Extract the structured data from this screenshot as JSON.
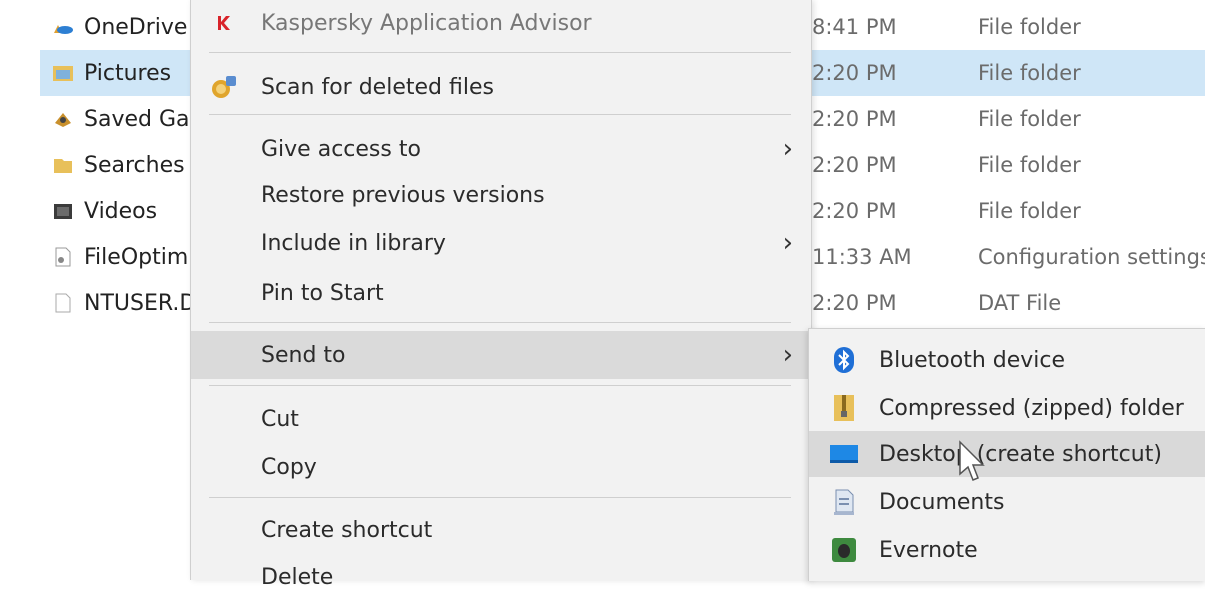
{
  "files": [
    {
      "name": "OneDrive",
      "date": "8:41 PM",
      "type": "File folder",
      "icon": "onedrive-icon",
      "selected": false
    },
    {
      "name": "Pictures",
      "date": "2:20 PM",
      "type": "File folder",
      "icon": "pictures-folder-icon",
      "selected": true
    },
    {
      "name": "Saved Games",
      "date": "2:20 PM",
      "type": "File folder",
      "icon": "saved-games-icon",
      "selected": false
    },
    {
      "name": "Searches",
      "date": "2:20 PM",
      "type": "File folder",
      "icon": "searches-folder-icon",
      "selected": false
    },
    {
      "name": "Videos",
      "date": "2:20 PM",
      "type": "File folder",
      "icon": "videos-folder-icon",
      "selected": false
    },
    {
      "name": "FileOptimizer",
      "date": "11:33 AM",
      "type": "Configuration settings",
      "icon": "config-file-icon",
      "selected": false
    },
    {
      "name": "NTUSER.DAT",
      "date": "2:20 PM",
      "type": "DAT File",
      "icon": "blank-file-icon",
      "selected": false
    }
  ],
  "context_menu": {
    "kaspersky": "Kaspersky Application Advisor",
    "scan_deleted": "Scan for deleted files",
    "give_access": "Give access to",
    "restore_versions": "Restore previous versions",
    "include_library": "Include in library",
    "pin_start": "Pin to Start",
    "send_to": "Send to",
    "cut": "Cut",
    "copy": "Copy",
    "create_shortcut": "Create shortcut",
    "delete": "Delete",
    "submenu_arrow": "›"
  },
  "send_to_menu": {
    "bluetooth": "Bluetooth device",
    "compressed": "Compressed (zipped) folder",
    "desktop": "Desktop (create shortcut)",
    "documents": "Documents",
    "evernote": "Evernote"
  },
  "colors": {
    "selection": "#cfe6f7",
    "menu_bg": "#f2f2f2",
    "menu_hover": "#dadada",
    "bluetooth": "#1f6fd6",
    "evernote": "#3e8a3f",
    "kaspersky": "#d8232a"
  }
}
